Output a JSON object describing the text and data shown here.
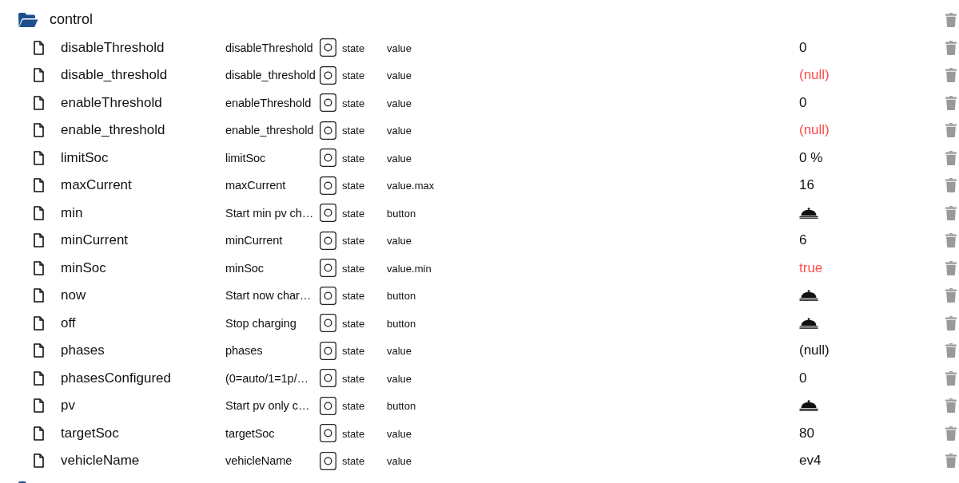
{
  "tree": {
    "name": "control",
    "expanded": true,
    "children": [
      {
        "name": "disableThreshold",
        "common_name": "disableThreshold",
        "type": "state",
        "role": "value",
        "kind": "text",
        "value": "0",
        "color": "#111111"
      },
      {
        "name": "disable_threshold",
        "common_name": "disable_threshold",
        "type": "state",
        "role": "value",
        "kind": "text",
        "value": "(null)",
        "color": "#ff4d4d"
      },
      {
        "name": "enableThreshold",
        "common_name": "enableThreshold",
        "type": "state",
        "role": "value",
        "kind": "text",
        "value": "0",
        "color": "#111111"
      },
      {
        "name": "enable_threshold",
        "common_name": "enable_threshold",
        "type": "state",
        "role": "value",
        "kind": "text",
        "value": "(null)",
        "color": "#ff4d4d"
      },
      {
        "name": "limitSoc",
        "common_name": "limitSoc",
        "type": "state",
        "role": "value",
        "kind": "text",
        "value": "0 %",
        "color": "#111111"
      },
      {
        "name": "maxCurrent",
        "common_name": "maxCurrent",
        "type": "state",
        "role": "value.max",
        "kind": "text",
        "value": "16",
        "color": "#111111"
      },
      {
        "name": "min",
        "common_name": "Start min pv ch…",
        "type": "state",
        "role": "button",
        "kind": "button"
      },
      {
        "name": "minCurrent",
        "common_name": "minCurrent",
        "type": "state",
        "role": "value",
        "kind": "text",
        "value": "6",
        "color": "#111111"
      },
      {
        "name": "minSoc",
        "common_name": "minSoc",
        "type": "state",
        "role": "value.min",
        "kind": "text",
        "value": "true",
        "color": "#ff4d4d"
      },
      {
        "name": "now",
        "common_name": "Start now char…",
        "type": "state",
        "role": "button",
        "kind": "button"
      },
      {
        "name": "off",
        "common_name": "Stop charging",
        "type": "state",
        "role": "button",
        "kind": "button"
      },
      {
        "name": "phases",
        "common_name": "phases",
        "type": "state",
        "role": "value",
        "kind": "text",
        "value": "(null)",
        "color": "#111111"
      },
      {
        "name": "phasesConfigured",
        "common_name": "(0=auto/1=1p/…",
        "type": "state",
        "role": "value",
        "kind": "text",
        "value": "0",
        "color": "#111111"
      },
      {
        "name": "pv",
        "common_name": "Start pv only c…",
        "type": "state",
        "role": "button",
        "kind": "button"
      },
      {
        "name": "targetSoc",
        "common_name": "targetSoc",
        "type": "state",
        "role": "value",
        "kind": "text",
        "value": "80",
        "color": "#111111"
      },
      {
        "name": "vehicleName",
        "common_name": "vehicleName",
        "type": "state",
        "role": "value",
        "kind": "text",
        "value": "ev4",
        "color": "#111111"
      }
    ]
  }
}
